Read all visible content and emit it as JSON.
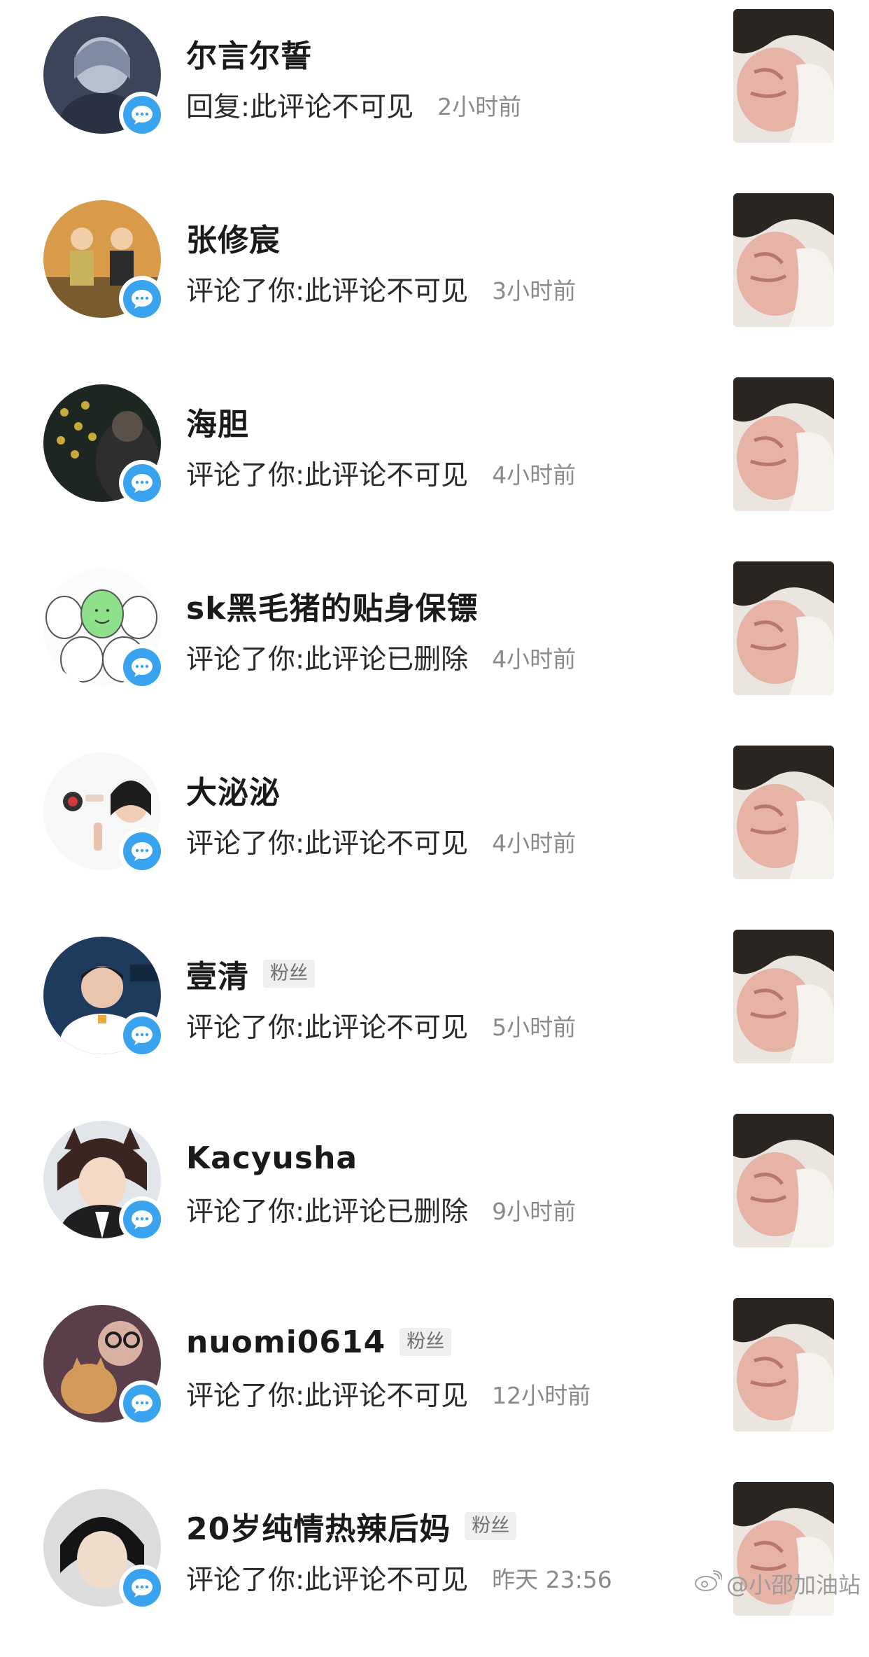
{
  "notifications": [
    {
      "name": "尔言尔誓",
      "action": "回复:",
      "comment": "此评论不可见",
      "time": "2小时前",
      "fan_tag": ""
    },
    {
      "name": "张修宸",
      "action": "评论了你:",
      "comment": "此评论不可见",
      "time": "3小时前",
      "fan_tag": ""
    },
    {
      "name": "海胆",
      "action": "评论了你:",
      "comment": "此评论不可见",
      "time": "4小时前",
      "fan_tag": ""
    },
    {
      "name": "sk黑毛猪的贴身保镖",
      "action": "评论了你:",
      "comment": "此评论已删除",
      "time": "4小时前",
      "fan_tag": ""
    },
    {
      "name": "大泌泌",
      "action": "评论了你:",
      "comment": "此评论不可见",
      "time": "4小时前",
      "fan_tag": ""
    },
    {
      "name": "壹清",
      "action": "评论了你:",
      "comment": "此评论不可见",
      "time": "5小时前",
      "fan_tag": "粉丝"
    },
    {
      "name": "Kacyusha",
      "action": "评论了你:",
      "comment": "此评论已删除",
      "time": "9小时前",
      "fan_tag": ""
    },
    {
      "name": "nuomi0614",
      "action": "评论了你:",
      "comment": "此评论不可见",
      "time": "12小时前",
      "fan_tag": "粉丝"
    },
    {
      "name": "20岁纯情热辣后妈",
      "action": "评论了你:",
      "comment": "此评论不可见",
      "time": "昨天 23:56",
      "fan_tag": "粉丝"
    }
  ],
  "watermark": {
    "text": "@小邵加油站",
    "icon": "weibo-icon"
  },
  "colors": {
    "badge": "#3aa3ef",
    "time_text": "#8a8a8a",
    "fan_tag_bg": "#efefef"
  }
}
